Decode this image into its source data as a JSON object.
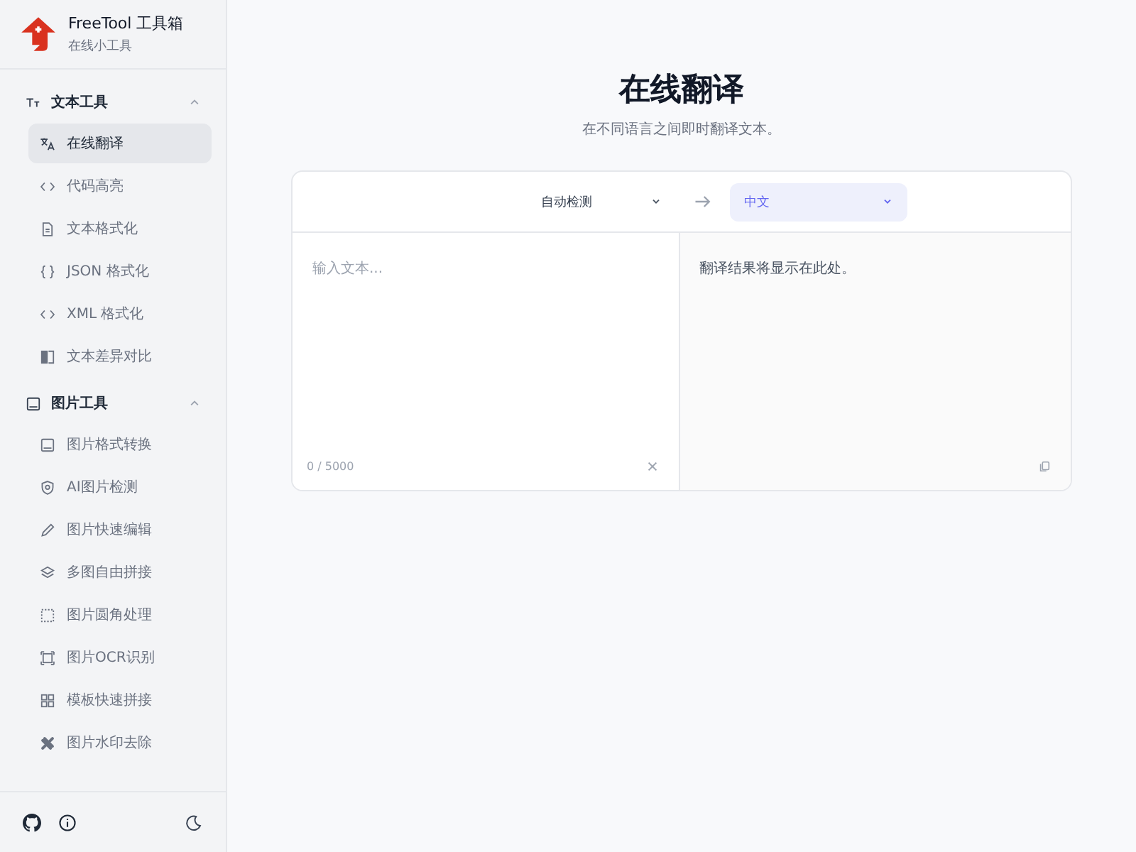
{
  "brand": {
    "name": "FreeTool 工具箱",
    "tagline": "在线小工具"
  },
  "sidebar": {
    "groups": [
      {
        "title": "文本工具",
        "expanded": true,
        "items": [
          {
            "label": "在线翻译",
            "selected": true
          },
          {
            "label": "代码高亮",
            "selected": false
          },
          {
            "label": "文本格式化",
            "selected": false
          },
          {
            "label": "JSON 格式化",
            "selected": false
          },
          {
            "label": "XML 格式化",
            "selected": false
          },
          {
            "label": "文本差异对比",
            "selected": false
          }
        ]
      },
      {
        "title": "图片工具",
        "expanded": true,
        "items": [
          {
            "label": "图片格式转换",
            "selected": false
          },
          {
            "label": "AI图片检测",
            "selected": false
          },
          {
            "label": "图片快速编辑",
            "selected": false
          },
          {
            "label": "多图自由拼接",
            "selected": false
          },
          {
            "label": "图片圆角处理",
            "selected": false
          },
          {
            "label": "图片OCR识别",
            "selected": false
          },
          {
            "label": "模板快速拼接",
            "selected": false
          },
          {
            "label": "图片水印去除",
            "selected": false
          }
        ]
      }
    ]
  },
  "page": {
    "title": "在线翻译",
    "subtitle": "在不同语言之间即时翻译文本。"
  },
  "translator": {
    "source_language": "自动检测",
    "target_language": "中文",
    "input_placeholder": "输入文本...",
    "output_placeholder": "翻译结果将显示在此处。",
    "char_count": "0 / 5000"
  }
}
